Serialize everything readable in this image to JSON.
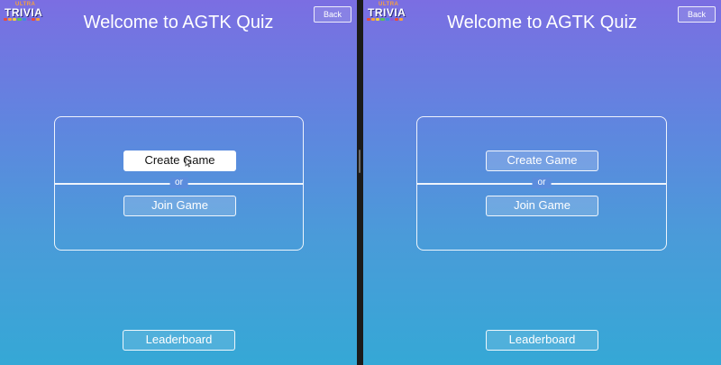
{
  "app": {
    "logo_top": "ULTRA",
    "logo_word": "TRIVIA",
    "logo_dot_colors": [
      "#e94b3c",
      "#f7a13b",
      "#f3d03e",
      "#5ac05a",
      "#3b8de0",
      "#8a5bd6",
      "#e94b3c",
      "#f7a13b"
    ]
  },
  "panes": [
    {
      "id": "left",
      "back_label": "Back",
      "title": "Welcome to AGTK Quiz",
      "create_label": "Create Game",
      "or_label": "or",
      "join_label": "Join Game",
      "leaderboard_label": "Leaderboard",
      "create_state": "hover"
    },
    {
      "id": "right",
      "back_label": "Back",
      "title": "Welcome to AGTK Quiz",
      "create_label": "Create Game",
      "or_label": "or",
      "join_label": "Join Game",
      "leaderboard_label": "Leaderboard",
      "create_state": "default"
    }
  ],
  "colors": {
    "gradient_top": "#7b6ee2",
    "gradient_bottom": "#35a8d6",
    "text": "#ffffff",
    "hover_button_bg": "#ffffff"
  }
}
